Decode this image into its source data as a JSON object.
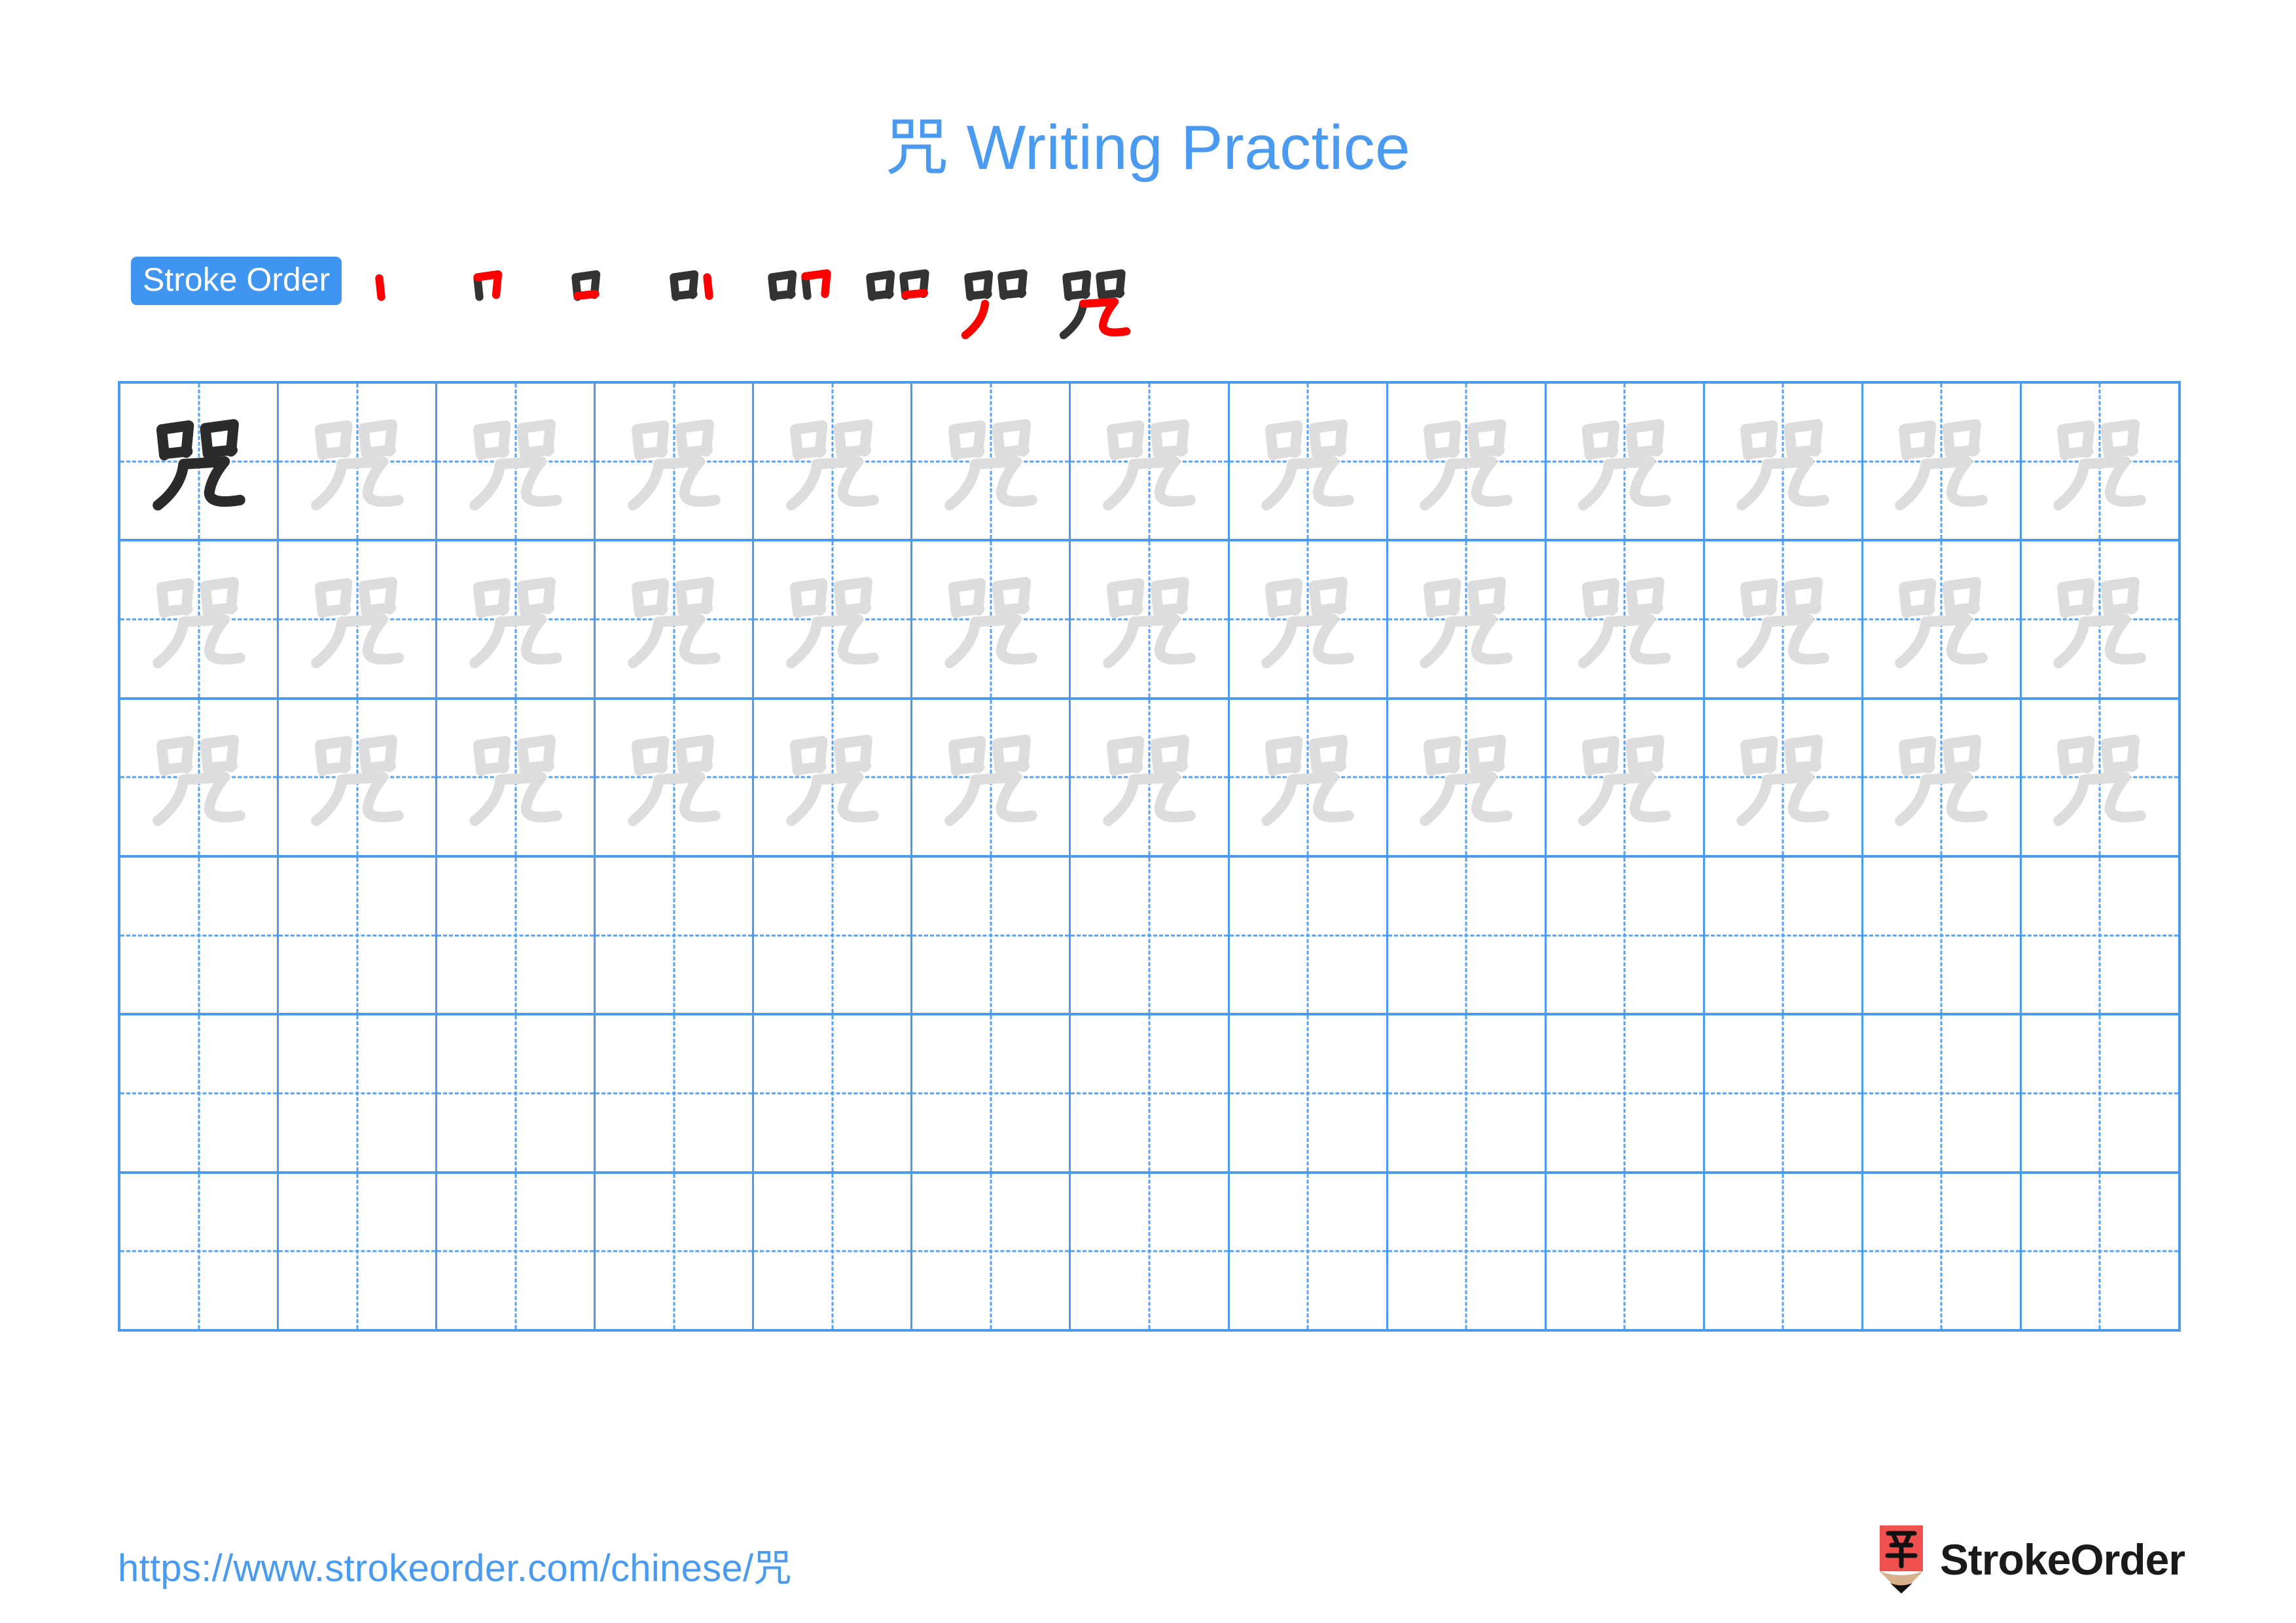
{
  "meta": {
    "character": "咒",
    "stroke_count": 8
  },
  "header": {
    "title_character": "咒",
    "title_text": " Writing Practice",
    "title_full": "咒 Writing Practice",
    "title_color": "#4a9bf0"
  },
  "stroke_order": {
    "badge_label": "Stroke Order",
    "badge_bg": "#4095f0",
    "badge_text_color": "#ffffff",
    "new_stroke_color": "#ff0000",
    "old_stroke_color": "#333333",
    "steps": [
      {
        "index": 1,
        "strokes_shown": 1,
        "new_stroke_name": "shu"
      },
      {
        "index": 2,
        "strokes_shown": 2,
        "new_stroke_name": "heng-zhe"
      },
      {
        "index": 3,
        "strokes_shown": 3,
        "new_stroke_name": "heng"
      },
      {
        "index": 4,
        "strokes_shown": 4,
        "new_stroke_name": "shu"
      },
      {
        "index": 5,
        "strokes_shown": 5,
        "new_stroke_name": "heng-zhe"
      },
      {
        "index": 6,
        "strokes_shown": 6,
        "new_stroke_name": "heng"
      },
      {
        "index": 7,
        "strokes_shown": 7,
        "new_stroke_name": "pie"
      },
      {
        "index": 8,
        "strokes_shown": 8,
        "new_stroke_name": "heng-zhe-wan-gou"
      }
    ]
  },
  "practice_grid": {
    "columns": 13,
    "rows": 6,
    "border_color": "#4a9bf0",
    "guide_color": "#57a2f2",
    "solid_glyph_color": "#2b2b2b",
    "trace_glyph_color": "#dddddd",
    "cells": [
      [
        "solid",
        "trace",
        "trace",
        "trace",
        "trace",
        "trace",
        "trace",
        "trace",
        "trace",
        "trace",
        "trace",
        "trace",
        "trace"
      ],
      [
        "trace",
        "trace",
        "trace",
        "trace",
        "trace",
        "trace",
        "trace",
        "trace",
        "trace",
        "trace",
        "trace",
        "trace",
        "trace"
      ],
      [
        "trace",
        "trace",
        "trace",
        "trace",
        "trace",
        "trace",
        "trace",
        "trace",
        "trace",
        "trace",
        "trace",
        "trace",
        "trace"
      ],
      [
        "empty",
        "empty",
        "empty",
        "empty",
        "empty",
        "empty",
        "empty",
        "empty",
        "empty",
        "empty",
        "empty",
        "empty",
        "empty"
      ],
      [
        "empty",
        "empty",
        "empty",
        "empty",
        "empty",
        "empty",
        "empty",
        "empty",
        "empty",
        "empty",
        "empty",
        "empty",
        "empty"
      ],
      [
        "empty",
        "empty",
        "empty",
        "empty",
        "empty",
        "empty",
        "empty",
        "empty",
        "empty",
        "empty",
        "empty",
        "empty",
        "empty"
      ]
    ]
  },
  "footer": {
    "url": "https://www.strokeorder.com/chinese/咒",
    "brand_name": "StrokeOrder",
    "brand_glyph": "字",
    "brand_pencil_color": "#f0514f",
    "brand_wood_color": "#d8b08c",
    "brand_tip_color": "#111111"
  }
}
